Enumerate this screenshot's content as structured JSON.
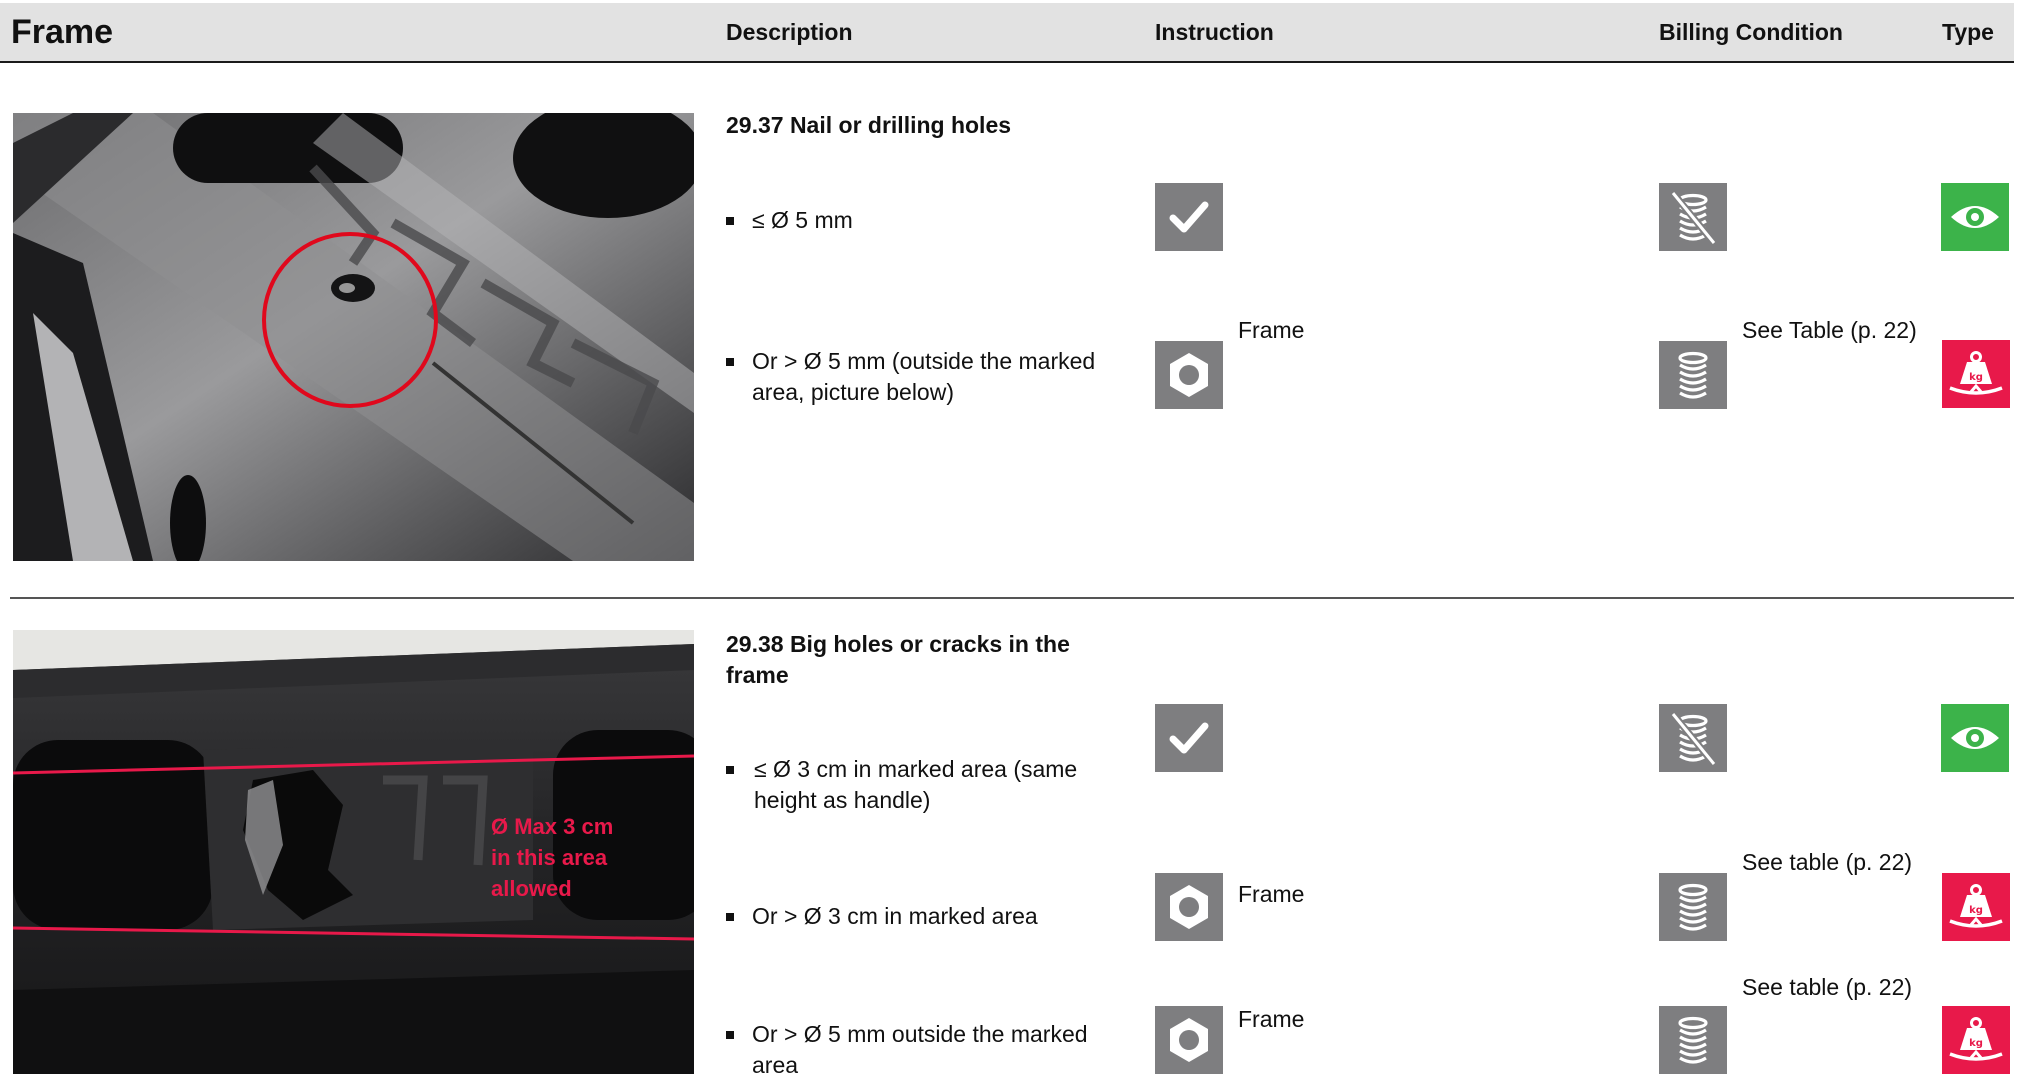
{
  "header": {
    "title": "Frame",
    "columns": {
      "description": "Description",
      "instruction": "Instruction",
      "billing": "Billing Condition",
      "type": "Type"
    }
  },
  "section1": {
    "title": "29.37 Nail or drilling holes",
    "rows": [
      {
        "text": "≤ Ø 5 mm",
        "instruction_icon": "check-icon",
        "instruction_text": "",
        "billing_icon": "no-coins-icon",
        "billing_text": "",
        "type_icon": "eye-icon"
      },
      {
        "text": "Or > Ø 5 mm (outside the marked area, picture below)",
        "instruction_icon": "nut-icon",
        "instruction_text": "Frame",
        "billing_icon": "coins-icon",
        "billing_text": "See Table (p. 22)",
        "type_icon": "weight-kg-icon"
      }
    ]
  },
  "section2": {
    "title": "29.38 Big holes or cracks in the frame",
    "photo_annotation": [
      "Ø Max 3 cm",
      "in this area",
      "allowed"
    ],
    "rows": [
      {
        "text": "≤ Ø 3 cm in marked area (same height as handle)",
        "instruction_icon": "check-icon",
        "instruction_text": "",
        "billing_icon": "no-coins-icon",
        "billing_text": "",
        "type_icon": "eye-icon"
      },
      {
        "text": "Or > Ø 3 cm in marked area",
        "instruction_icon": "nut-icon",
        "instruction_text": "Frame",
        "billing_icon": "coins-icon",
        "billing_text": "See table (p. 22)",
        "type_icon": "weight-kg-icon"
      },
      {
        "text": "Or > Ø 5 mm outside the marked area",
        "instruction_icon": "nut-icon",
        "instruction_text": "Frame",
        "billing_icon": "coins-icon",
        "billing_text": "See table (p. 22)",
        "type_icon": "weight-kg-icon"
      }
    ]
  },
  "colors": {
    "green": "#3cb34a",
    "red": "#e8194a",
    "grey": "#7e7e80",
    "header": "#e2e2e2"
  }
}
